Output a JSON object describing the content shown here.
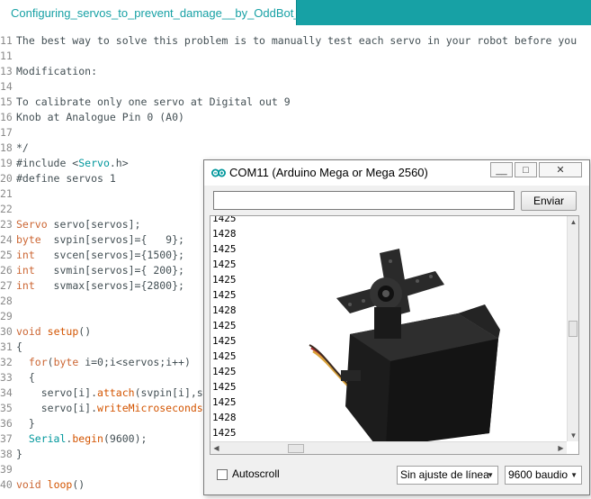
{
  "tab": {
    "label": "Configuring_servos_to_prevent_damage__by_OddBot_"
  },
  "code": [
    {
      "n": "11",
      "text": "The best way to solve this problem is to manually test each servo in your robot before you"
    },
    {
      "n": "11",
      "text": ""
    },
    {
      "n": "13",
      "text": "Modification:"
    },
    {
      "n": "14",
      "text": ""
    },
    {
      "n": "15",
      "text": "To calibrate only one servo at Digital out 9"
    },
    {
      "n": "16",
      "text": "Knob at Analogue Pin 0 (A0)"
    },
    {
      "n": "17",
      "text": ""
    },
    {
      "n": "18",
      "text": "*/"
    },
    {
      "n": "19",
      "pre": "#include <",
      "cls": "Servo",
      "post": ".h>"
    },
    {
      "n": "20",
      "text": "#define servos 1"
    },
    {
      "n": "21",
      "text": ""
    },
    {
      "n": "22",
      "text": ""
    },
    {
      "n": "23",
      "kw": "Servo",
      "rest": " servo[servos];"
    },
    {
      "n": "24",
      "kw": "byte",
      "rest": "  svpin[servos]={   9};"
    },
    {
      "n": "25",
      "kw": "int",
      "rest": "   svcen[servos]={1500};"
    },
    {
      "n": "26",
      "kw": "int",
      "rest": "   svmin[servos]={ 200};"
    },
    {
      "n": "27",
      "kw": "int",
      "rest": "   svmax[servos]={2800};"
    },
    {
      "n": "28",
      "text": ""
    },
    {
      "n": "29",
      "text": ""
    },
    {
      "n": "30",
      "kw": "void",
      "fn": "setup",
      "rest": "()"
    },
    {
      "n": "31",
      "text": "{"
    },
    {
      "n": "32",
      "indent": "  ",
      "kw": "for",
      "rest": "(",
      "kw2": "byte",
      "rest2": " i=0;i<servos;i++)"
    },
    {
      "n": "33",
      "text": "  {"
    },
    {
      "n": "34",
      "indent": "    ",
      "rest": "servo[i].",
      "fn": "attach",
      "rest2": "(svpin[i],s"
    },
    {
      "n": "35",
      "indent": "    ",
      "rest": "servo[i].",
      "fn": "writeMicroseconds",
      "rest2": ""
    },
    {
      "n": "36",
      "text": "  }"
    },
    {
      "n": "37",
      "indent": "  ",
      "cl": "Serial",
      "rest": ".",
      "fn": "begin",
      "rest2": "(9600);"
    },
    {
      "n": "38",
      "text": "}"
    },
    {
      "n": "39",
      "text": ""
    },
    {
      "n": "40",
      "kw": "void",
      "fn": "loop",
      "rest": "()"
    }
  ],
  "serial_monitor": {
    "title": "COM11 (Arduino Mega or Mega 2560)",
    "minimize": "__",
    "maximize": "□",
    "close": "✕",
    "send_label": "Enviar",
    "send_value": "",
    "output_lines": [
      "1425",
      "1428",
      "1425",
      "1425",
      "1425",
      "1425",
      "1428",
      "1425",
      "1425",
      "1425",
      "1425",
      "1425",
      "1425",
      "1428",
      "1425"
    ],
    "autoscroll_label": "Autoscroll",
    "line_ending": "Sin ajuste de línea",
    "baud": "9600 baudio"
  },
  "colors": {
    "tab_bar": "#17a1a5",
    "keyword": "#cc6633",
    "class": "#00979c"
  }
}
